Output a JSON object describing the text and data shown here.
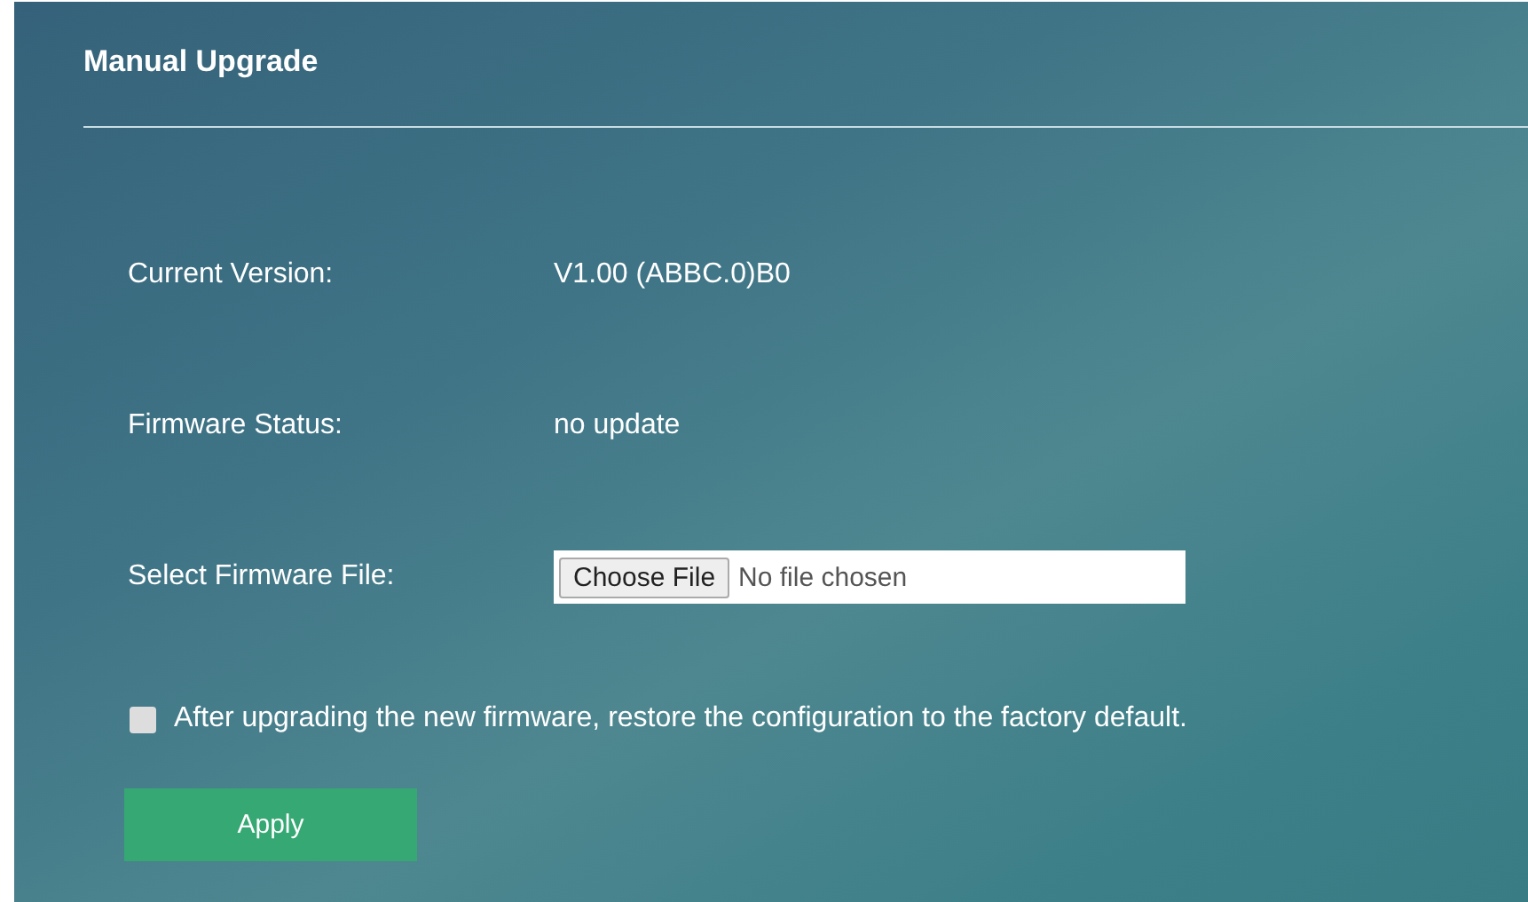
{
  "section": {
    "title": "Manual Upgrade"
  },
  "fields": [
    {
      "kind": "text",
      "label": "Current Version:",
      "value": "V1.00 (ABBC.0)B0"
    },
    {
      "kind": "text",
      "label": "Firmware Status:",
      "value": "no update"
    },
    {
      "kind": "file",
      "label": "Select Firmware File:",
      "button": "Choose File",
      "value": "No file chosen"
    }
  ],
  "option": {
    "label": "After upgrading the new firmware, restore the configuration to the factory default.",
    "checked": false
  },
  "buttons": [
    "Apply"
  ]
}
